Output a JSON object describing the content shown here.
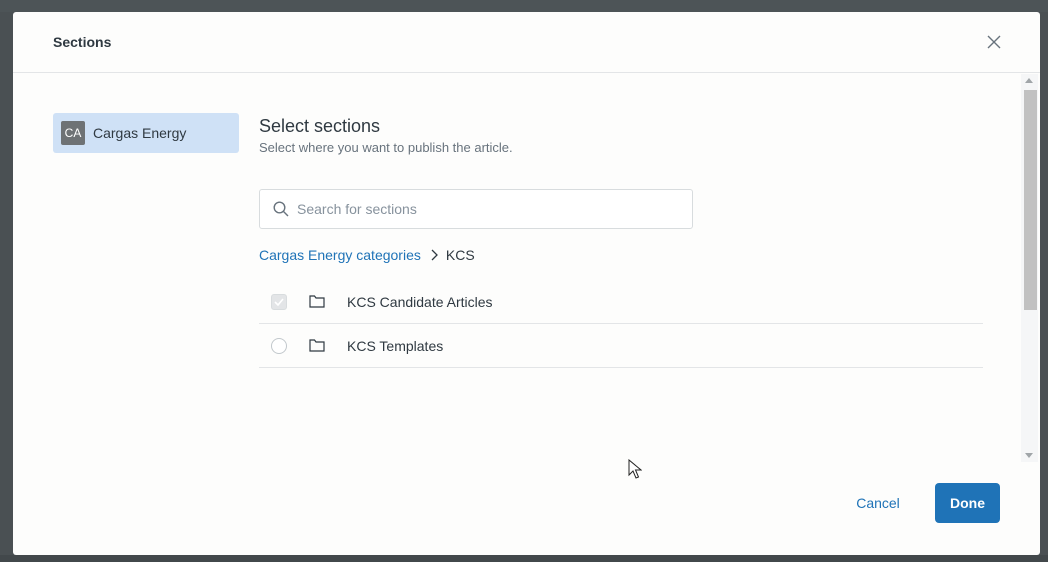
{
  "modal": {
    "title": "Sections"
  },
  "sidebar": {
    "items": [
      {
        "initials": "CA",
        "label": "Cargas Energy",
        "selected": true
      }
    ]
  },
  "main": {
    "title": "Select sections",
    "subtitle": "Select where you want to publish the article.",
    "search": {
      "placeholder": "Search for sections",
      "value": ""
    },
    "breadcrumb": {
      "parent": "Cargas Energy categories",
      "current": "KCS"
    },
    "sections": [
      {
        "label": "KCS Candidate Articles",
        "selected": true,
        "disabled": true,
        "icon": "folder-icon"
      },
      {
        "label": "KCS Templates",
        "selected": false,
        "disabled": false,
        "icon": "folder-icon"
      }
    ]
  },
  "footer": {
    "cancel_label": "Cancel",
    "done_label": "Done"
  },
  "colors": {
    "accent": "#1f73b7",
    "selected_bg": "#cfe1f6"
  }
}
